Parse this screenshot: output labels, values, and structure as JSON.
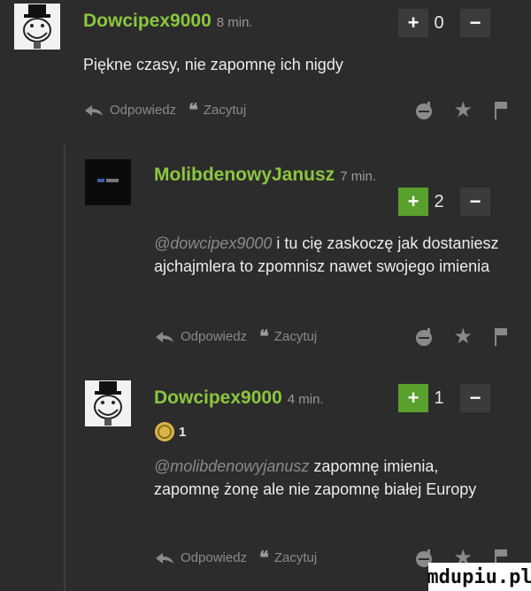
{
  "comments": [
    {
      "username": "Dowcipex9000",
      "time": "8 min.",
      "text": "Piękne czasy, nie zapomnę ich nigdy",
      "votes": "0",
      "actions": {
        "reply": "Odpowiedz",
        "quote": "Zacytuj"
      }
    },
    {
      "username": "MolibdenowyJanusz",
      "time": "7 min.",
      "mention": "@dowcipex9000",
      "text": " i tu cię zaskoczę jak dostaniesz ajchajmlera to zpomnisz nawet swojego imienia",
      "votes": "2",
      "actions": {
        "reply": "Odpowiedz",
        "quote": "Zacytuj"
      }
    },
    {
      "username": "Dowcipex9000",
      "time": "4 min.",
      "badge_count": "1",
      "mention": "@molibdenowyjanusz",
      "text": " zapomnę imienia, zapomnę żonę ale nie zapomnę białej Europy",
      "votes": "1",
      "actions": {
        "reply": "Odpowiedz",
        "quote": "Zacytuj"
      }
    }
  ],
  "watermark": "mdupiu.pl",
  "colors": {
    "username": "#8cc63f",
    "vote_green": "#5aa02c",
    "background": "#2c2c2c"
  },
  "icons": [
    "reply-arrow-icon",
    "quote-icon",
    "bomb-icon",
    "star-icon",
    "flag-icon",
    "plus-icon",
    "minus-icon",
    "coin-badge-icon"
  ]
}
